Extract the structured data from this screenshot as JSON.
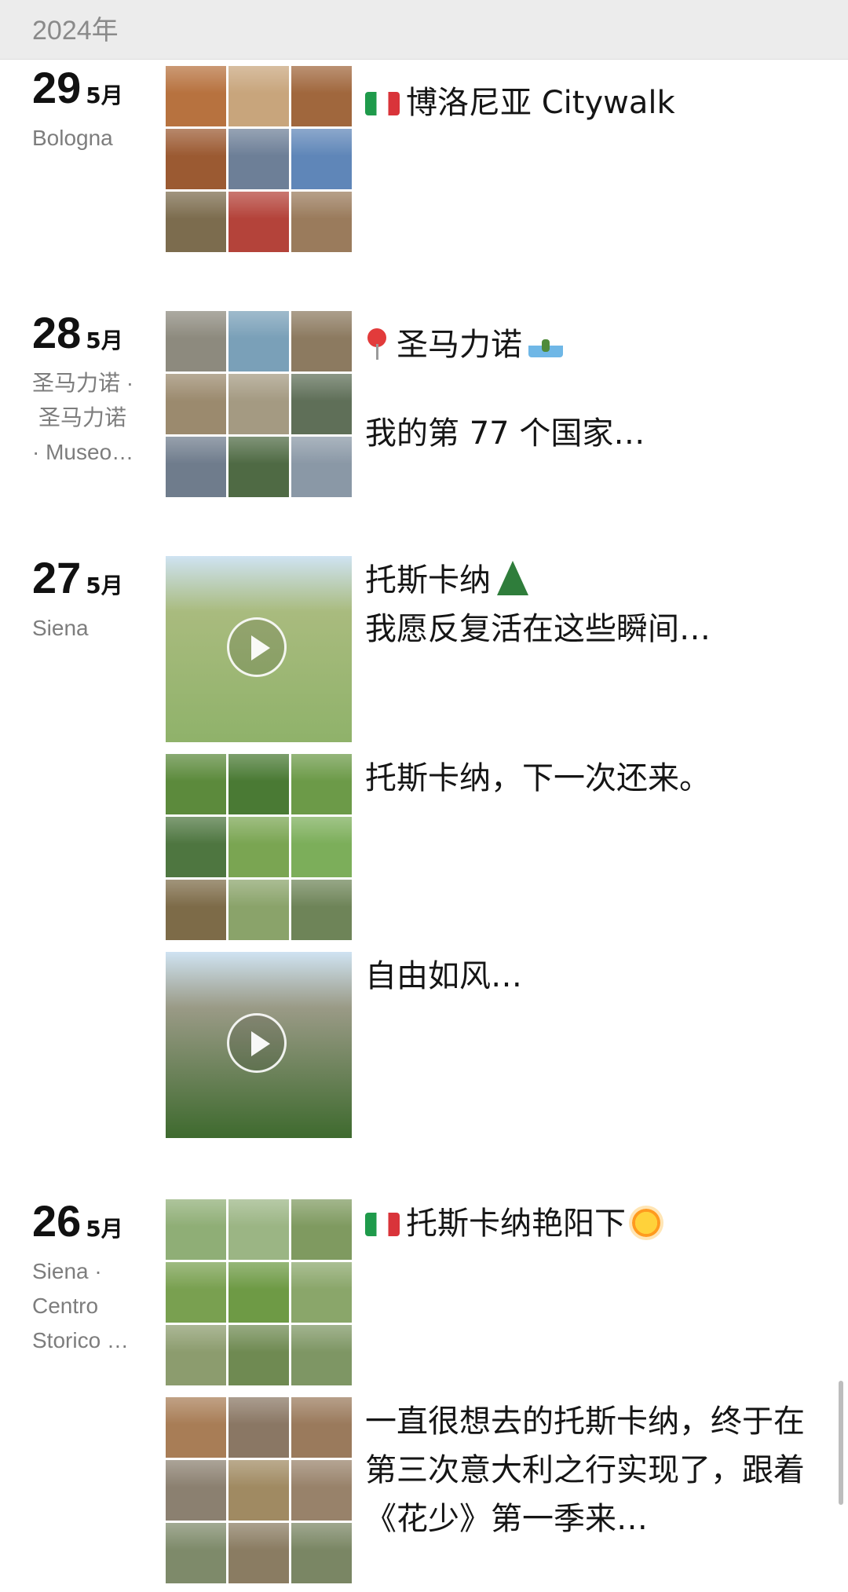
{
  "header": {
    "year": "2024年"
  },
  "days": [
    {
      "day": "29",
      "month": "5月",
      "location": [
        "Bologna"
      ],
      "posts": [
        {
          "kind": "grid",
          "caption_prefix_icon": "italy-flag",
          "caption": "博洛尼亚 Citywalk",
          "colors": [
            "#b7723f",
            "#c8a57c",
            "#a0673d",
            "#9b5a32",
            "#6d7f97",
            "#5f86b8",
            "#7c6c4e",
            "#b4433a",
            "#9a7b5c"
          ]
        }
      ]
    },
    {
      "day": "28",
      "month": "5月",
      "location": [
        "圣马力诺 ·",
        "圣马力诺",
        "· Museo…"
      ],
      "posts": [
        {
          "kind": "grid",
          "caption_prefix_icon": "pin-icon",
          "caption": "圣马力诺",
          "caption_suffix_icon": "san-marino-flag",
          "caption2": "我的第 77 个国家…",
          "colors": [
            "#8d8a7e",
            "#7aa0b8",
            "#8c7a60",
            "#9b8a6e",
            "#a49a82",
            "#5f6f58",
            "#6f7c8c",
            "#4f6a44",
            "#8a98a6"
          ]
        }
      ]
    },
    {
      "day": "27",
      "month": "5月",
      "location": [
        "Siena"
      ],
      "posts": [
        {
          "kind": "video",
          "caption": "托斯卡纳",
          "caption_suffix_icon": "tree-icon",
          "caption2": "我愿反复活在这些瞬间…",
          "colors": [
            "#8fb26a",
            "#a9bb7e"
          ]
        },
        {
          "kind": "grid",
          "caption": "托斯卡纳，下一次还来。",
          "colors": [
            "#5c8a3c",
            "#4a7a34",
            "#6c9a48",
            "#4e7640",
            "#7aa552",
            "#7cae5a",
            "#7d6b48",
            "#8aa36a",
            "#6e8458"
          ]
        },
        {
          "kind": "video",
          "caption": "自由如风…",
          "colors": [
            "#3e6a2e",
            "#9a9a86"
          ]
        }
      ]
    },
    {
      "day": "26",
      "month": "5月",
      "location": [
        "Siena ·",
        "Centro",
        "Storico …"
      ],
      "posts": [
        {
          "kind": "grid",
          "caption_prefix_icon": "italy-flag",
          "caption": "托斯卡纳艳阳下",
          "caption_suffix_icon": "sun-icon",
          "colors": [
            "#8fae76",
            "#9bb584",
            "#7f9a60",
            "#79a050",
            "#6e9a45",
            "#8aa66a",
            "#8c9c6e",
            "#6f8a52",
            "#7e9664"
          ]
        },
        {
          "kind": "grid",
          "caption": "一直很想去的托斯卡纳，终于在第三次意大利之行实现了，跟着《花少》第一季来…",
          "colors": [
            "#a87d56",
            "#8a7764",
            "#9a7a5c",
            "#8b8070",
            "#a08a62",
            "#98826a",
            "#7e8a6a",
            "#8a7c62",
            "#7a8664"
          ]
        }
      ]
    }
  ]
}
